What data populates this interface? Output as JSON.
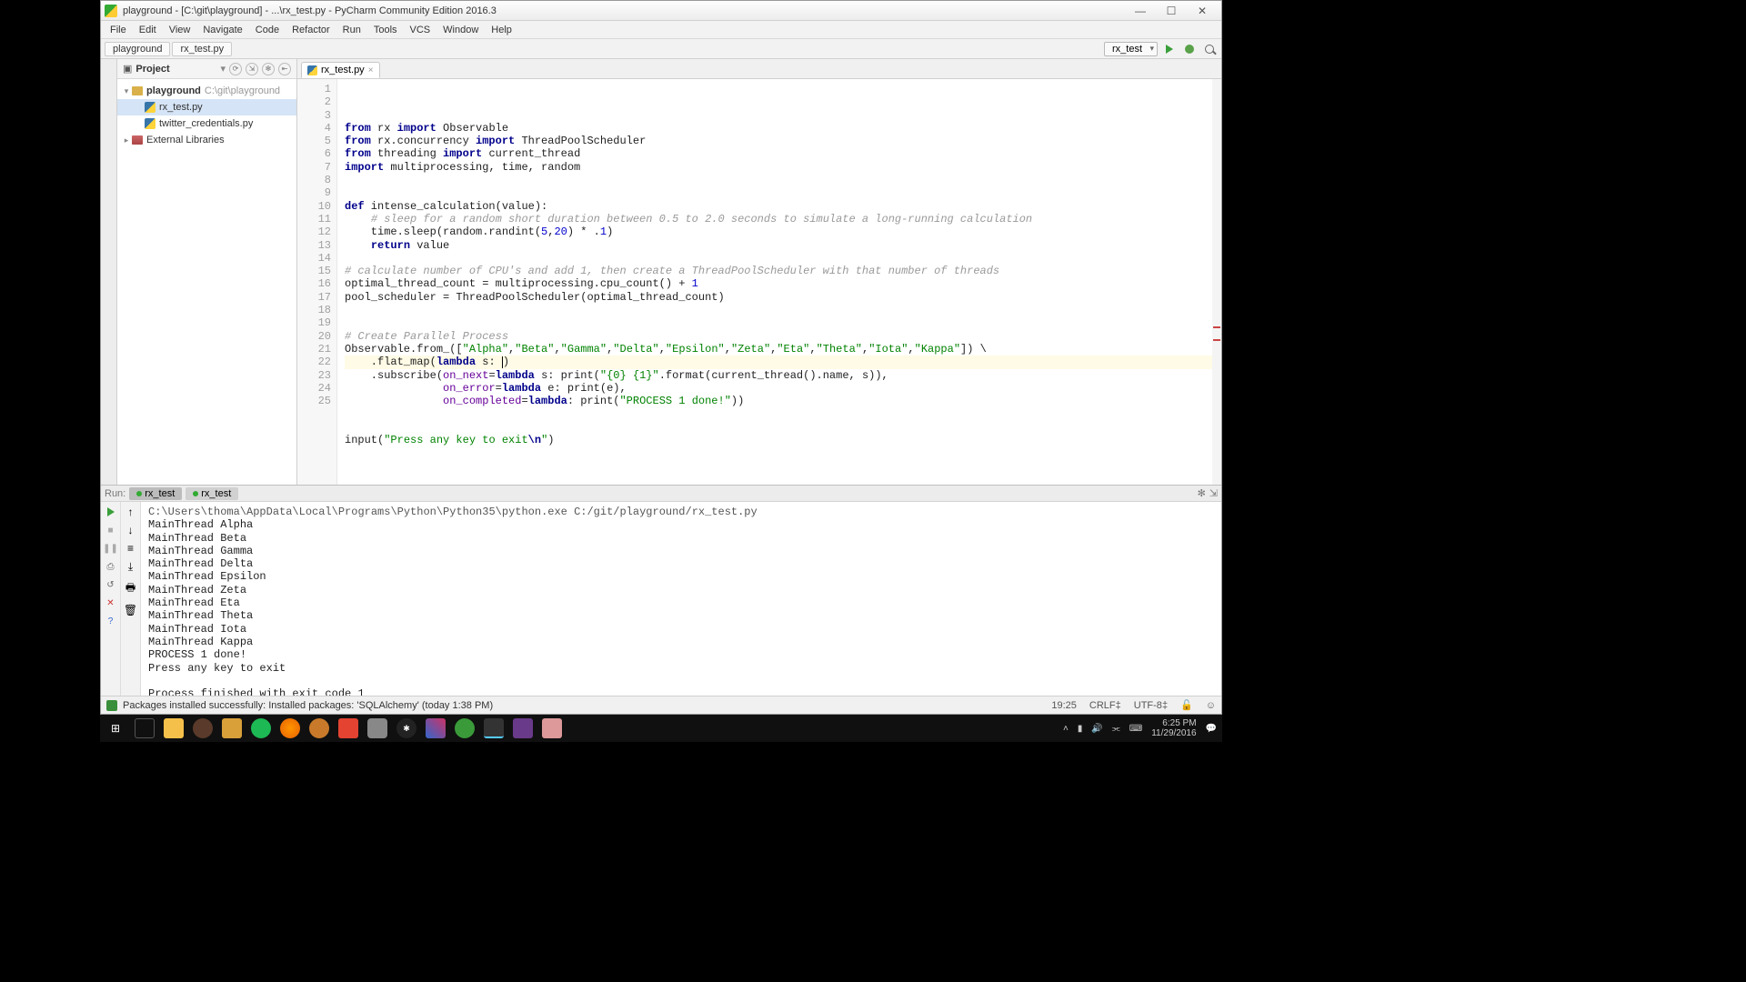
{
  "window": {
    "title": "playground - [C:\\git\\playground] - ...\\rx_test.py - PyCharm Community Edition 2016.3"
  },
  "menus": [
    "File",
    "Edit",
    "View",
    "Navigate",
    "Code",
    "Refactor",
    "Run",
    "Tools",
    "VCS",
    "Window",
    "Help"
  ],
  "breadcrumbs": [
    "playground",
    "rx_test.py"
  ],
  "run_config": "rx_test",
  "project": {
    "label": "Project",
    "root": {
      "name": "playground",
      "path": "C:\\git\\playground"
    },
    "files": [
      "rx_test.py",
      "twitter_credentials.py"
    ],
    "external": "External Libraries"
  },
  "editor": {
    "tab": "rx_test.py",
    "cursor_line": 19
  },
  "code_lines": [
    {
      "n": 1,
      "seg": [
        [
          "kw",
          "from"
        ],
        [
          "",
          " rx "
        ],
        [
          "kw",
          "import"
        ],
        [
          "",
          " Observable"
        ]
      ]
    },
    {
      "n": 2,
      "seg": [
        [
          "kw",
          "from"
        ],
        [
          "",
          " rx.concurrency "
        ],
        [
          "kw",
          "import"
        ],
        [
          "",
          " ThreadPoolScheduler"
        ]
      ]
    },
    {
      "n": 3,
      "seg": [
        [
          "kw",
          "from"
        ],
        [
          "",
          " threading "
        ],
        [
          "kw",
          "import"
        ],
        [
          "",
          " current_thread"
        ]
      ]
    },
    {
      "n": 4,
      "seg": [
        [
          "kw",
          "import"
        ],
        [
          "",
          " multiprocessing, time, random"
        ]
      ]
    },
    {
      "n": 5,
      "seg": []
    },
    {
      "n": 6,
      "seg": []
    },
    {
      "n": 7,
      "seg": [
        [
          "kw",
          "def"
        ],
        [
          "",
          " intense_calculation(value):"
        ]
      ]
    },
    {
      "n": 8,
      "seg": [
        [
          "",
          "    "
        ],
        [
          "cm",
          "# sleep for a random short duration between 0.5 to 2.0 seconds to simulate a long-running calculation"
        ]
      ]
    },
    {
      "n": 9,
      "seg": [
        [
          "",
          "    time.sleep(random.randint("
        ],
        [
          "nm",
          "5"
        ],
        [
          "",
          ","
        ],
        [
          "nm",
          "20"
        ],
        [
          "",
          ") * ."
        ],
        [
          "nm",
          "1"
        ],
        [
          "",
          ")"
        ]
      ]
    },
    {
      "n": 10,
      "seg": [
        [
          "",
          "    "
        ],
        [
          "kw",
          "return"
        ],
        [
          "",
          " value"
        ]
      ]
    },
    {
      "n": 11,
      "seg": []
    },
    {
      "n": 12,
      "seg": [
        [
          "cm",
          "# calculate number of CPU's and add 1, then create a ThreadPoolScheduler with that number of threads"
        ]
      ]
    },
    {
      "n": 13,
      "seg": [
        [
          "",
          "optimal_thread_count = multiprocessing.cpu_count() + "
        ],
        [
          "nm",
          "1"
        ]
      ]
    },
    {
      "n": 14,
      "seg": [
        [
          "",
          "pool_scheduler = ThreadPoolScheduler(optimal_thread_count)"
        ]
      ]
    },
    {
      "n": 15,
      "seg": []
    },
    {
      "n": 16,
      "seg": []
    },
    {
      "n": 17,
      "seg": [
        [
          "cm",
          "# Create Parallel Process"
        ]
      ]
    },
    {
      "n": 18,
      "seg": [
        [
          "",
          "Observable.from_(["
        ],
        [
          "st",
          "\"Alpha\""
        ],
        [
          "",
          ","
        ],
        [
          "st",
          "\"Beta\""
        ],
        [
          "",
          ","
        ],
        [
          "st",
          "\"Gamma\""
        ],
        [
          "",
          ","
        ],
        [
          "st",
          "\"Delta\""
        ],
        [
          "",
          ","
        ],
        [
          "st",
          "\"Epsilon\""
        ],
        [
          "",
          ","
        ],
        [
          "st",
          "\"Zeta\""
        ],
        [
          "",
          ","
        ],
        [
          "st",
          "\"Eta\""
        ],
        [
          "",
          ","
        ],
        [
          "st",
          "\"Theta\""
        ],
        [
          "",
          ","
        ],
        [
          "st",
          "\"Iota\""
        ],
        [
          "",
          ","
        ],
        [
          "st",
          "\"Kappa\""
        ],
        [
          "",
          "]) \\"
        ]
      ]
    },
    {
      "n": 19,
      "hl": true,
      "seg": [
        [
          "",
          "    .flat_map("
        ],
        [
          "kw",
          "lambda"
        ],
        [
          "",
          " s: "
        ],
        [
          "caret",
          ""
        ],
        [
          "",
          ")"
        ]
      ]
    },
    {
      "n": 20,
      "seg": [
        [
          "",
          "    .subscribe("
        ],
        [
          "pa",
          "on_next"
        ],
        [
          "",
          "="
        ],
        [
          "kw",
          "lambda"
        ],
        [
          "",
          " s: print("
        ],
        [
          "st",
          "\"{0} {1}\""
        ],
        [
          "",
          ".format(current_thread().name, s)),"
        ]
      ]
    },
    {
      "n": 21,
      "seg": [
        [
          "",
          "               "
        ],
        [
          "pa",
          "on_error"
        ],
        [
          "",
          "="
        ],
        [
          "kw",
          "lambda"
        ],
        [
          "",
          " e: print(e),"
        ]
      ]
    },
    {
      "n": 22,
      "seg": [
        [
          "",
          "               "
        ],
        [
          "pa",
          "on_completed"
        ],
        [
          "",
          "="
        ],
        [
          "kw",
          "lambda"
        ],
        [
          "",
          ": print("
        ],
        [
          "st",
          "\"PROCESS 1 done!\""
        ],
        [
          "",
          "))"
        ]
      ]
    },
    {
      "n": 23,
      "seg": []
    },
    {
      "n": 24,
      "seg": []
    },
    {
      "n": 25,
      "seg": [
        [
          "",
          "input("
        ],
        [
          "st",
          "\"Press any key to exit"
        ],
        [
          "kw",
          "\\n"
        ],
        [
          "st",
          "\""
        ],
        [
          "",
          ")"
        ]
      ]
    }
  ],
  "run": {
    "label": "Run:",
    "tabs": [
      "rx_test",
      "rx_test"
    ],
    "cmd": "C:\\Users\\thoma\\AppData\\Local\\Programs\\Python\\Python35\\python.exe C:/git/playground/rx_test.py",
    "lines": [
      "MainThread Alpha",
      "MainThread Beta",
      "MainThread Gamma",
      "MainThread Delta",
      "MainThread Epsilon",
      "MainThread Zeta",
      "MainThread Eta",
      "MainThread Theta",
      "MainThread Iota",
      "MainThread Kappa",
      "PROCESS 1 done!",
      "Press any key to exit",
      "",
      "Process finished with exit code 1"
    ]
  },
  "status": {
    "msg": "Packages installed successfully: Installed packages: 'SQLAlchemy' (today 1:38 PM)",
    "pos": "19:25",
    "eol": "CRLF",
    "enc": "UTF-8"
  },
  "tray": {
    "time": "6:25 PM",
    "date": "11/29/2016"
  }
}
